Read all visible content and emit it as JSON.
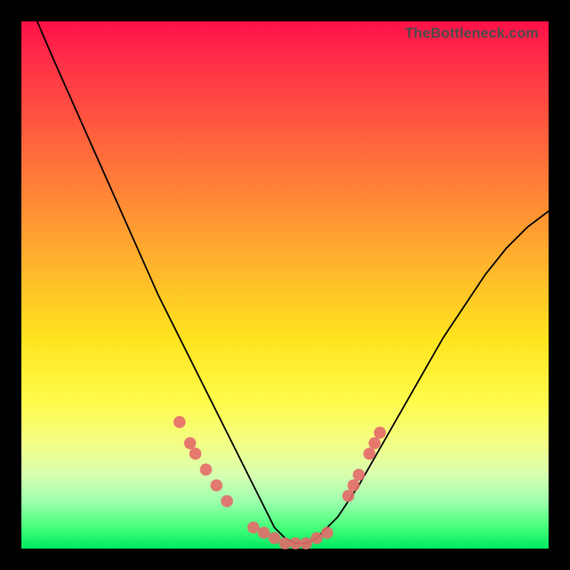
{
  "watermark": "TheBottleneck.com",
  "chart_data": {
    "type": "line",
    "title": "",
    "xlabel": "",
    "ylabel": "",
    "xlim": [
      0,
      100
    ],
    "ylim": [
      0,
      100
    ],
    "grid": false,
    "legend": false,
    "series": [
      {
        "name": "bottleneck-curve",
        "color": "#000000",
        "x": [
          3,
          6,
          10,
          14,
          18,
          22,
          26,
          30,
          34,
          38,
          42,
          46,
          48,
          50,
          52,
          54,
          56,
          60,
          64,
          68,
          72,
          76,
          80,
          84,
          88,
          92,
          96,
          100
        ],
        "y": [
          100,
          93,
          84,
          75,
          66,
          57,
          48,
          40,
          32,
          24,
          16,
          8,
          4,
          2,
          1,
          1,
          2,
          6,
          12,
          19,
          26,
          33,
          40,
          46,
          52,
          57,
          61,
          64
        ]
      }
    ],
    "markers": [
      {
        "name": "left-cluster",
        "color": "#e46a6a",
        "shape": "circle",
        "points": [
          {
            "x": 30,
            "y": 24
          },
          {
            "x": 32,
            "y": 20
          },
          {
            "x": 33,
            "y": 18
          },
          {
            "x": 35,
            "y": 15
          },
          {
            "x": 37,
            "y": 12
          },
          {
            "x": 39,
            "y": 9
          }
        ]
      },
      {
        "name": "bottom-cluster",
        "color": "#e46a6a",
        "shape": "circle",
        "points": [
          {
            "x": 44,
            "y": 4
          },
          {
            "x": 46,
            "y": 3
          },
          {
            "x": 48,
            "y": 2
          },
          {
            "x": 50,
            "y": 1
          },
          {
            "x": 52,
            "y": 1
          },
          {
            "x": 54,
            "y": 1
          },
          {
            "x": 56,
            "y": 2
          },
          {
            "x": 58,
            "y": 3
          }
        ]
      },
      {
        "name": "right-cluster",
        "color": "#e46a6a",
        "shape": "circle",
        "points": [
          {
            "x": 62,
            "y": 10
          },
          {
            "x": 63,
            "y": 12
          },
          {
            "x": 64,
            "y": 14
          },
          {
            "x": 66,
            "y": 18
          },
          {
            "x": 67,
            "y": 20
          },
          {
            "x": 68,
            "y": 22
          }
        ]
      }
    ]
  }
}
